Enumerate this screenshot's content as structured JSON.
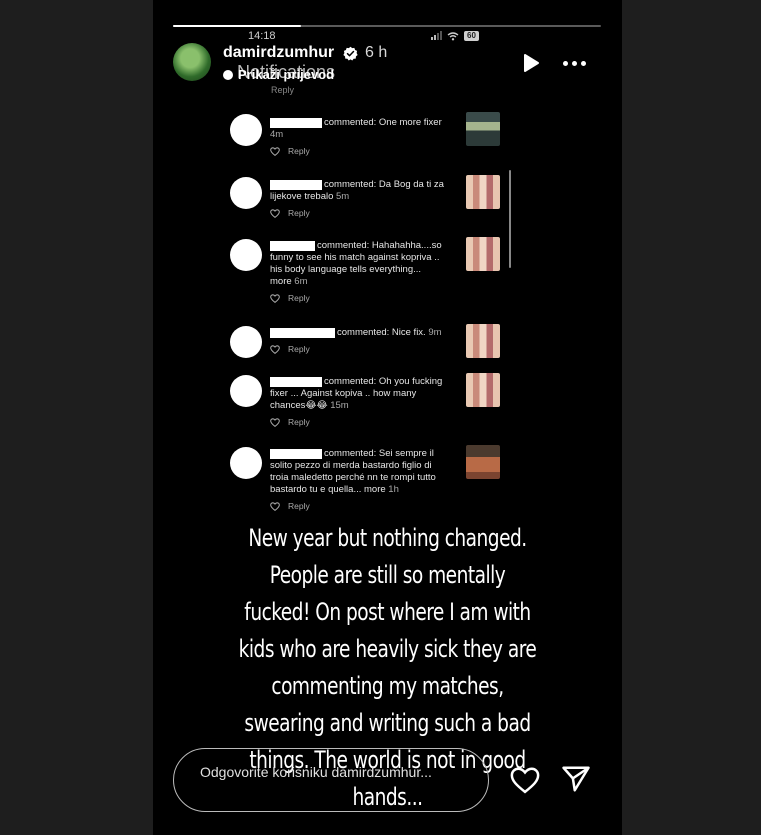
{
  "status_bar": {
    "time": "14:18",
    "battery": "60"
  },
  "story": {
    "progress": 0.3,
    "username": "damirdzumhur",
    "time_ago": "6 h",
    "notifications_label": "Notifications",
    "show_original_label": "Prikaži prijevod"
  },
  "screenshot": {
    "top_reply_label": "Reply",
    "comments": [
      {
        "text": "commented: One more fixer",
        "time": "4m",
        "reply": "Reply",
        "thumb": "arena"
      },
      {
        "text": "commented: Da Bog da ti za lijekove trebalo",
        "time": "5m",
        "reply": "Reply",
        "thumb": "kids"
      },
      {
        "text": "commented: Hahahahha....so funny to see his match against kopriva .. his body language tells everything... more",
        "time": "6m",
        "reply": "Reply",
        "thumb": "kids"
      },
      {
        "text": "commented: Nice fix.",
        "time": "9m",
        "reply": "Reply",
        "thumb": "kids"
      },
      {
        "text": "commented: Oh you fucking fixer ... Against kopiva .. how many chances😂😂",
        "time": "15m",
        "reply": "Reply",
        "thumb": "kids"
      },
      {
        "text": "commented: Sei sempre il solito pezzo di merda bastardo figlio di troia maledetto perché nn te rompi tutto bastardo tu e quella... more",
        "time": "1h",
        "reply": "Reply",
        "thumb": "clay"
      }
    ]
  },
  "caption_lines": [
    "New year but nothing changed.",
    "People are still so mentally",
    "fucked! On post where I am with",
    "kids who are heavily sick they are",
    "commenting my matches,",
    "swearing and writing such a bad",
    "things. The world is not in good",
    "hands..."
  ],
  "reply_bar": {
    "placeholder": "Odgovorite korisniku damirdzumhur..."
  },
  "icons": {
    "verified": "verified-badge-icon",
    "play": "play-icon",
    "more": "more-options-icon",
    "like": "heart-icon",
    "send": "send-icon"
  }
}
